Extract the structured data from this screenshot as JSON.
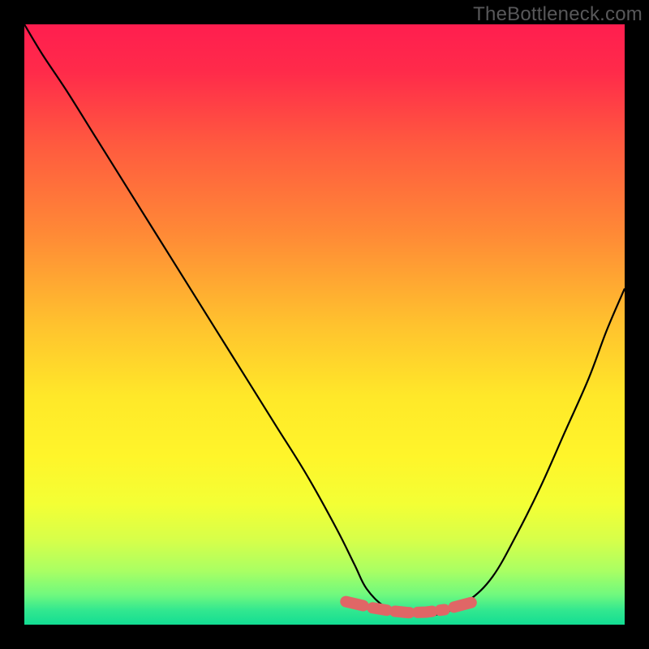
{
  "watermark": "TheBottleneck.com",
  "chart_data": {
    "type": "line",
    "title": "",
    "xlabel": "",
    "ylabel": "",
    "xlim": [
      0,
      100
    ],
    "ylim": [
      0,
      100
    ],
    "grid": false,
    "legend": false,
    "background_gradient_stops": [
      {
        "offset": 0,
        "color": "#ff1e4f"
      },
      {
        "offset": 0.08,
        "color": "#ff2b4a"
      },
      {
        "offset": 0.2,
        "color": "#ff5a3f"
      },
      {
        "offset": 0.35,
        "color": "#ff8a36"
      },
      {
        "offset": 0.5,
        "color": "#ffc22e"
      },
      {
        "offset": 0.62,
        "color": "#ffe829"
      },
      {
        "offset": 0.72,
        "color": "#fff52a"
      },
      {
        "offset": 0.8,
        "color": "#f3ff35"
      },
      {
        "offset": 0.86,
        "color": "#d6ff4a"
      },
      {
        "offset": 0.91,
        "color": "#aaff63"
      },
      {
        "offset": 0.95,
        "color": "#70f97e"
      },
      {
        "offset": 0.975,
        "color": "#34e88f"
      },
      {
        "offset": 1.0,
        "color": "#12dd93"
      }
    ],
    "series": [
      {
        "name": "bottleneck-curve",
        "color": "#000000",
        "x": [
          0,
          3,
          7,
          12,
          17,
          22,
          27,
          32,
          37,
          42,
          47,
          52,
          55,
          57,
          60,
          63,
          66,
          70,
          74,
          78,
          82,
          86,
          90,
          94,
          97,
          100
        ],
        "y": [
          100,
          95,
          89,
          81,
          73,
          65,
          57,
          49,
          41,
          33,
          25,
          16,
          10,
          6,
          3,
          2,
          1.5,
          2,
          4,
          8,
          15,
          23,
          32,
          41,
          49,
          56
        ]
      },
      {
        "name": "bottom-dotted-band",
        "color": "#e06666",
        "style": "dotted-wide",
        "x": [
          55,
          58,
          61,
          64,
          67,
          70,
          73
        ],
        "y": [
          3.5,
          2.8,
          2.3,
          2.0,
          2.1,
          2.5,
          3.3
        ]
      }
    ]
  }
}
